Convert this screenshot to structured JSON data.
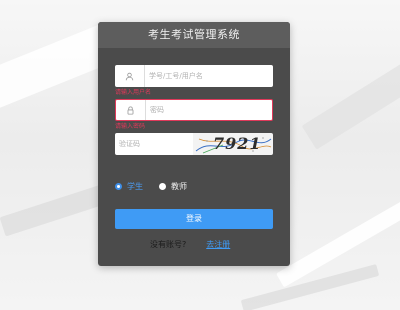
{
  "header": {
    "title": "考生考试管理系统"
  },
  "form": {
    "username": {
      "icon": "user-icon",
      "value": "",
      "placeholder": "学号/工号/用户名",
      "error": "请输入用户名"
    },
    "password": {
      "icon": "lock-icon",
      "value": "",
      "placeholder": "密码",
      "error": "请输入密码"
    },
    "captcha": {
      "value": "",
      "placeholder": "验证码",
      "image_code": "7921"
    },
    "roles": [
      {
        "label": "学生",
        "checked": true
      },
      {
        "label": "教师",
        "checked": false
      }
    ],
    "login_button": "登录",
    "register_prompt": "没有账号?",
    "register_link": "去注册"
  },
  "colors": {
    "panel": "#4b4b4b",
    "panel_header": "#5d5d5d",
    "primary": "#3f9bf5",
    "error": "#e0395a"
  }
}
